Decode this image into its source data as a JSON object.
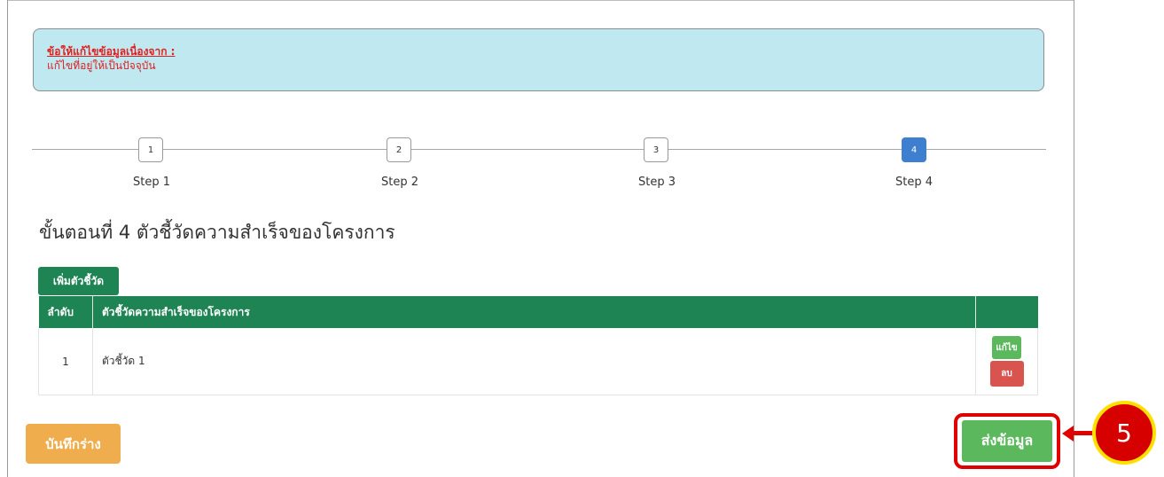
{
  "alert": {
    "title": "ข้อให้แก้ไขข้อมูลเนื่องจาก :",
    "body": "แก้ไขที่อยู่ให้เป็นปัจจุบัน"
  },
  "steps": [
    {
      "number": "1",
      "label": "Step 1",
      "active": false
    },
    {
      "number": "2",
      "label": "Step 2",
      "active": false
    },
    {
      "number": "3",
      "label": "Step 3",
      "active": false
    },
    {
      "number": "4",
      "label": "Step 4",
      "active": true
    }
  ],
  "heading": "ขั้นตอนที่ 4 ตัวชี้วัดความสำเร็จของโครงการ",
  "add_button": "เพิ่มตัวชี้วัด",
  "table": {
    "headers": [
      "ลำดับ",
      "ตัวชี้วัดความสำเร็จของโครงการ",
      ""
    ],
    "rows": [
      {
        "index": "1",
        "name": "ตัวชี้วัด 1",
        "edit_label": "แก้ไข",
        "delete_label": "ลบ"
      }
    ]
  },
  "draft_button": "บันทึกร่าง",
  "submit_button": "ส่งข้อมูล",
  "callout": "5",
  "colors": {
    "primary_green": "#1e8454",
    "success_green": "#5cb85c",
    "danger_red": "#d9534f",
    "warning_orange": "#f0ad4e",
    "active_step_blue": "#3e7fcf",
    "alert_bg": "#bfe8f0",
    "highlight_red": "#e00000",
    "callout_border_yellow": "#ffe000"
  }
}
